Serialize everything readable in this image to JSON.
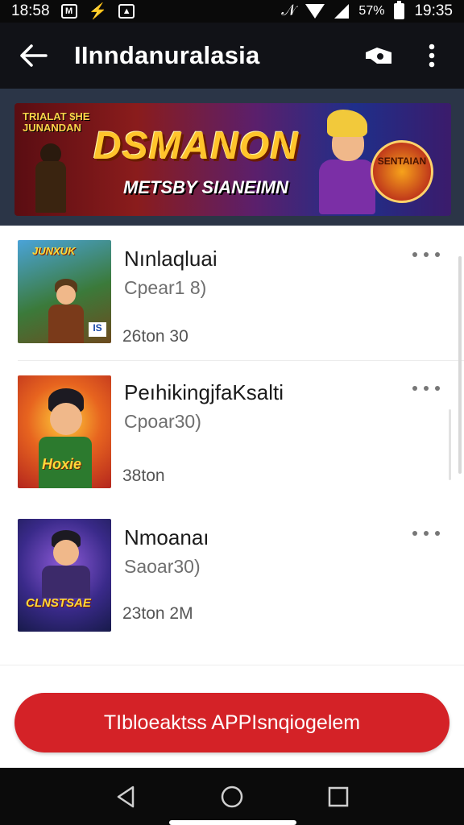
{
  "status_bar": {
    "time_left": "18:58",
    "time": "19:35",
    "battery": "57%",
    "icons": [
      "gmail-icon",
      "usb-icon",
      "image-icon",
      "nfc-icon",
      "wifi-icon",
      "signal-icon",
      "battery-icon"
    ]
  },
  "app_bar": {
    "title": "IInndanuralasia",
    "actions": [
      "share-icon",
      "more-vert-icon"
    ]
  },
  "banner": {
    "tag": "TRIALAT $HE JUNANDAN",
    "title": "DSMANON",
    "subtitle": "METSBY SIANEIMN",
    "badge": "SENTAIAN"
  },
  "items": [
    {
      "name": "Nınlaqluai",
      "meta": "Cpear1 8)",
      "foot": "26ton 30"
    },
    {
      "name": "PeıhikingjfaKsalti",
      "meta": "Cpoar30)",
      "foot": "38ton"
    },
    {
      "name": "Nmoanaı",
      "meta": "Saoar30)",
      "foot": "23ton 2M"
    }
  ],
  "cta": {
    "label": "TIbloeaktss APPIsnqiogelem"
  },
  "colors": {
    "accent": "#d42227",
    "app_bar": "#111217",
    "banner_bg": "#2b3547"
  }
}
